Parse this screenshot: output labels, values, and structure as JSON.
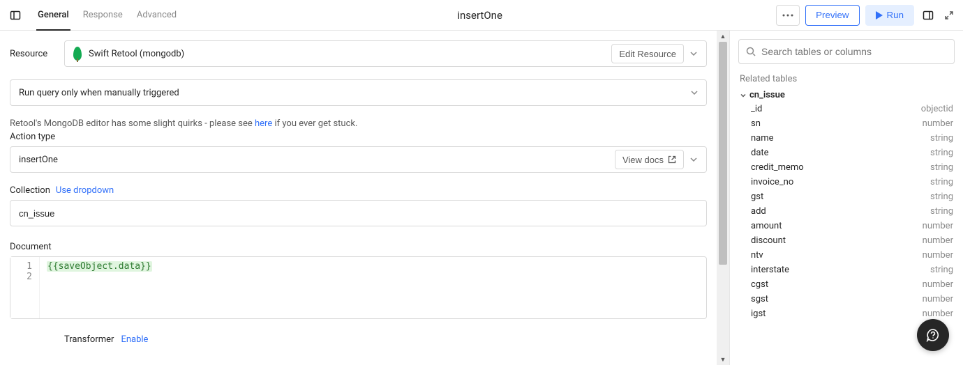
{
  "header": {
    "tabs": [
      "General",
      "Response",
      "Advanced"
    ],
    "active_tab": 0,
    "title": "insertOne",
    "preview_label": "Preview",
    "run_label": "Run"
  },
  "resource": {
    "label": "Resource",
    "name": "Swift Retool (mongodb)",
    "edit_label": "Edit Resource"
  },
  "trigger": {
    "value": "Run query only when manually triggered"
  },
  "hint": {
    "prefix": "Retool's MongoDB editor has some slight quirks - please see ",
    "link": "here",
    "suffix": " if you ever get stuck."
  },
  "action": {
    "label": "Action type",
    "value": "insertOne",
    "view_docs": "View docs"
  },
  "collection": {
    "label": "Collection",
    "use_dropdown": "Use dropdown",
    "value": "cn_issue"
  },
  "document": {
    "label": "Document",
    "lines": [
      "1",
      "2"
    ],
    "code": "{{saveObject.data}}"
  },
  "transformer": {
    "label": "Transformer",
    "enable": "Enable"
  },
  "search": {
    "placeholder": "Search tables or columns"
  },
  "related_label": "Related tables",
  "table": {
    "name": "cn_issue",
    "fields": [
      {
        "name": "_id",
        "type": "objectid"
      },
      {
        "name": "sn",
        "type": "number"
      },
      {
        "name": "name",
        "type": "string"
      },
      {
        "name": "date",
        "type": "string"
      },
      {
        "name": "credit_memo",
        "type": "string"
      },
      {
        "name": "invoice_no",
        "type": "string"
      },
      {
        "name": "gst",
        "type": "string"
      },
      {
        "name": "add",
        "type": "string"
      },
      {
        "name": "amount",
        "type": "number"
      },
      {
        "name": "discount",
        "type": "number"
      },
      {
        "name": "ntv",
        "type": "number"
      },
      {
        "name": "interstate",
        "type": "string"
      },
      {
        "name": "cgst",
        "type": "number"
      },
      {
        "name": "sgst",
        "type": "number"
      },
      {
        "name": "igst",
        "type": "number"
      }
    ]
  }
}
